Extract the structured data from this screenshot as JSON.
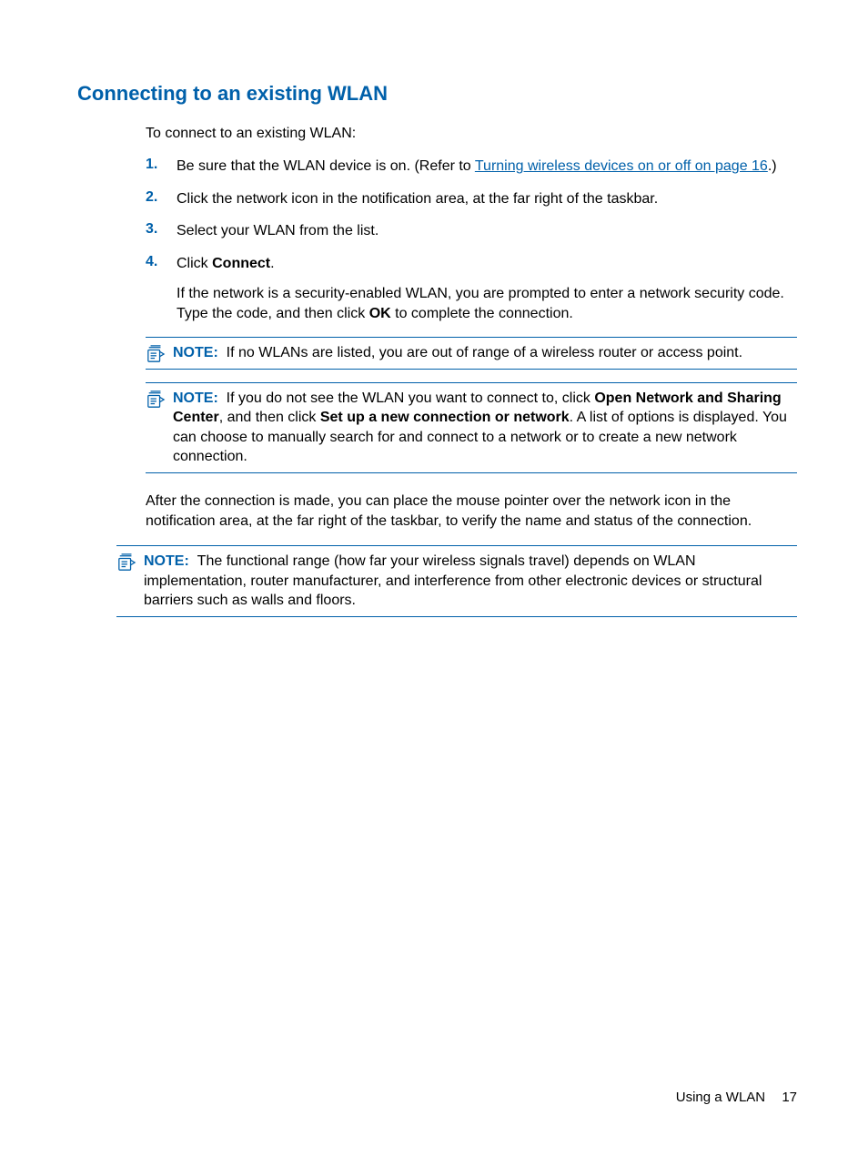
{
  "heading": "Connecting to an existing WLAN",
  "intro": "To connect to an existing WLAN:",
  "steps": [
    {
      "num": "1.",
      "pre": "Be sure that the WLAN device is on. (Refer to ",
      "link": "Turning wireless devices on or off on page 16",
      "post": ".)"
    },
    {
      "num": "2.",
      "text": "Click the network icon in the notification area, at the far right of the taskbar."
    },
    {
      "num": "3.",
      "text": "Select your WLAN from the list."
    },
    {
      "num": "4.",
      "pre": "Click ",
      "bold": "Connect",
      "post": ".",
      "para2_pre": "If the network is a security-enabled WLAN, you are prompted to enter a network security code. Type the code, and then click ",
      "para2_bold": "OK",
      "para2_post": " to complete the connection."
    }
  ],
  "note_label": "NOTE:",
  "note1": "If no WLANs are listed, you are out of range of a wireless router or access point.",
  "note2_pre": "If you do not see the WLAN you want to connect to, click ",
  "note2_b1": "Open Network and Sharing Center",
  "note2_mid": ", and then click ",
  "note2_b2": "Set up a new connection or network",
  "note2_post": ". A list of options is displayed. You can choose to manually search for and connect to a network or to create a new network connection.",
  "after": "After the connection is made, you can place the mouse pointer over the network icon in the notification area, at the far right of the taskbar, to verify the name and status of the connection.",
  "note3": "The functional range (how far your wireless signals travel) depends on WLAN implementation, router manufacturer, and interference from other electronic devices or structural barriers such as walls and floors.",
  "footer_section": "Using a WLAN",
  "footer_page": "17"
}
